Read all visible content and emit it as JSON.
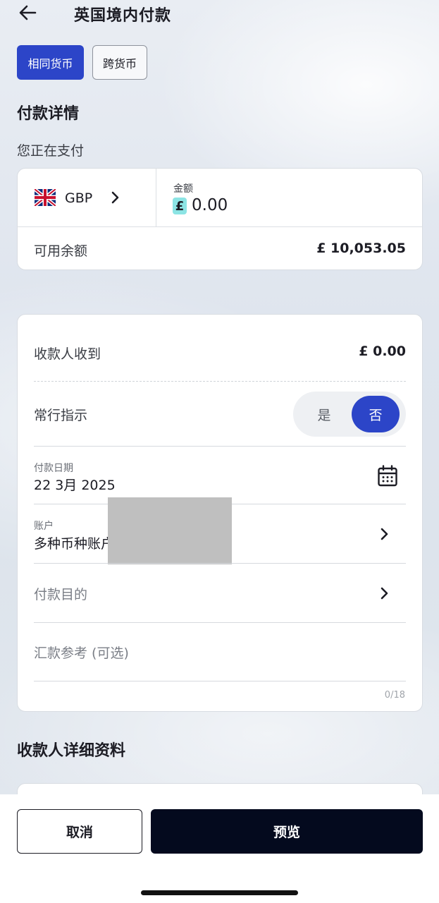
{
  "header": {
    "title": "英国境内付款"
  },
  "segments": {
    "same_currency": "相同货币",
    "cross_currency": "跨货币"
  },
  "payment_details": {
    "section_title": "付款详情",
    "paying_label": "您正在支付",
    "currency_code": "GBP",
    "amount_label": "金额",
    "currency_symbol": "£",
    "amount_value": "0.00",
    "available_label": "可用余额",
    "available_value": "£ 10,053.05"
  },
  "details": {
    "recipient_receives_label": "收款人收到",
    "recipient_receives_value": "£ 0.00",
    "standing_order_label": "常行指示",
    "toggle_yes": "是",
    "toggle_no": "否",
    "payment_date_label": "付款日期",
    "payment_date_value": "22 3月 2025",
    "account_label": "账户",
    "account_value": "多种币种账户",
    "purpose_label": "付款目的",
    "reference_placeholder": "汇款参考 (可选)",
    "reference_counter": "0/18"
  },
  "recipient": {
    "section_title": "收款人详细资料"
  },
  "footer": {
    "cancel_label": "取消",
    "preview_label": "预览"
  },
  "icons": {
    "back": "arrow-left-icon",
    "flag": "uk-flag-icon",
    "chevron": "chevron-right-icon",
    "calendar": "calendar-icon"
  },
  "colors": {
    "accent": "#2c45c8",
    "primary_button": "#040a1e",
    "currency_badge": "#8ce4e4"
  }
}
